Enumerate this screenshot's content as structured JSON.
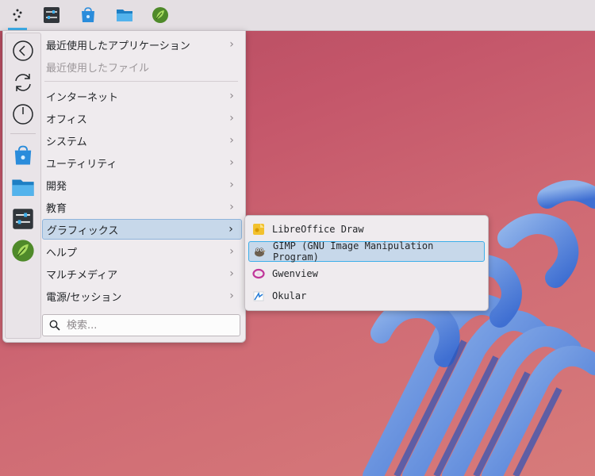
{
  "panel": {
    "items": [
      {
        "name": "kickoff-launcher"
      },
      {
        "name": "system-settings"
      },
      {
        "name": "discover"
      },
      {
        "name": "dolphin"
      },
      {
        "name": "libreoffice-draw"
      }
    ]
  },
  "menu": {
    "categories": [
      {
        "label": "最近使用したアプリケーション",
        "disabled": false
      },
      {
        "label": "最近使用したファイル",
        "disabled": true
      },
      {
        "label": "インターネット"
      },
      {
        "label": "オフィス"
      },
      {
        "label": "システム"
      },
      {
        "label": "ユーティリティ"
      },
      {
        "label": "開発"
      },
      {
        "label": "教育"
      },
      {
        "label": "グラフィックス",
        "selected": true
      },
      {
        "label": "ヘルプ"
      },
      {
        "label": "マルチメディア"
      },
      {
        "label": "電源/セッション"
      }
    ],
    "search_placeholder": "検索..."
  },
  "submenu": {
    "items": [
      {
        "label": "LibreOffice Draw",
        "icon": "libreoffice-draw-icon"
      },
      {
        "label": "GIMP (GNU Image Manipulation Program)",
        "icon": "gimp-icon",
        "selected": true
      },
      {
        "label": "Gwenview",
        "icon": "gwenview-icon"
      },
      {
        "label": "Okular",
        "icon": "okular-icon"
      }
    ]
  },
  "colors": {
    "accent": "#3daee9",
    "selection": "#c7d8ea",
    "wallpaper": "#c4566a"
  }
}
